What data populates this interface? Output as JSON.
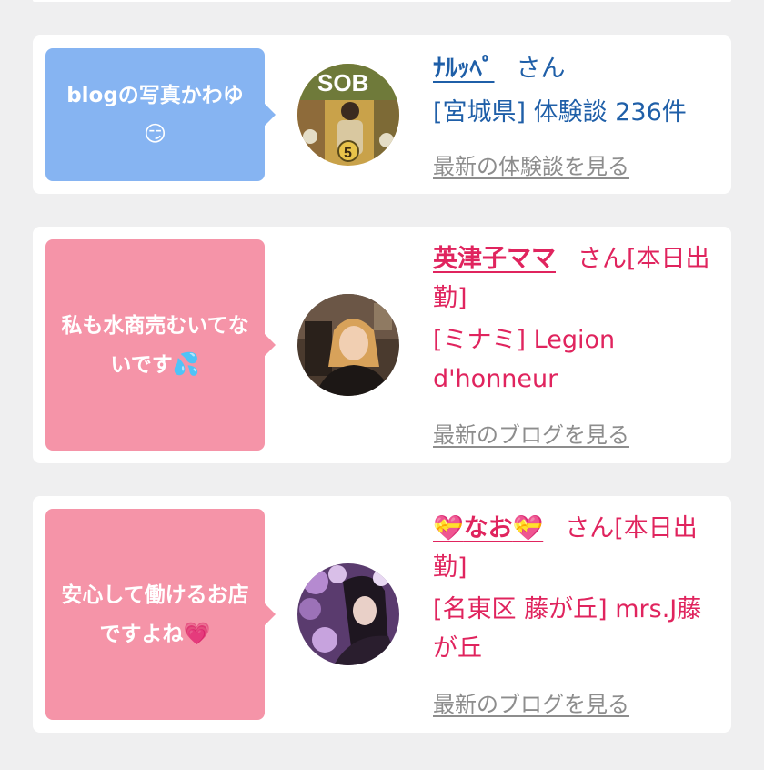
{
  "cards": [
    {
      "bubble_text": "blogの写真かわゆ",
      "bubble_emoji": "😏",
      "name": "ﾅﾙｯﾍﾟ",
      "san": "さん",
      "shop": "[宮城県] 体験談 236件",
      "more_link": "最新の体験談を見る",
      "theme_color": "#1f5fa8",
      "bubble_color": "#86b4f2"
    },
    {
      "bubble_text": "私も水商売むいてないです",
      "bubble_emoji": "💦",
      "name": "英津子ママ",
      "san": "さん[本日出勤]",
      "shop": "[ミナミ] Legion d'honneur",
      "more_link": "最新のブログを見る",
      "theme_color": "#e0245e",
      "bubble_color": "#f594a8"
    },
    {
      "bubble_text": "安心して働けるお店ですよね",
      "bubble_emoji": "💗",
      "name_prefix_icon": "💝",
      "name": "なお",
      "name_suffix_icon": "💝",
      "san": "さん[本日出勤]",
      "shop": "[名東区 藤が丘] mrs.J藤が丘",
      "more_link": "最新のブログを見る",
      "theme_color": "#e0245e",
      "bubble_color": "#f594a8"
    }
  ]
}
